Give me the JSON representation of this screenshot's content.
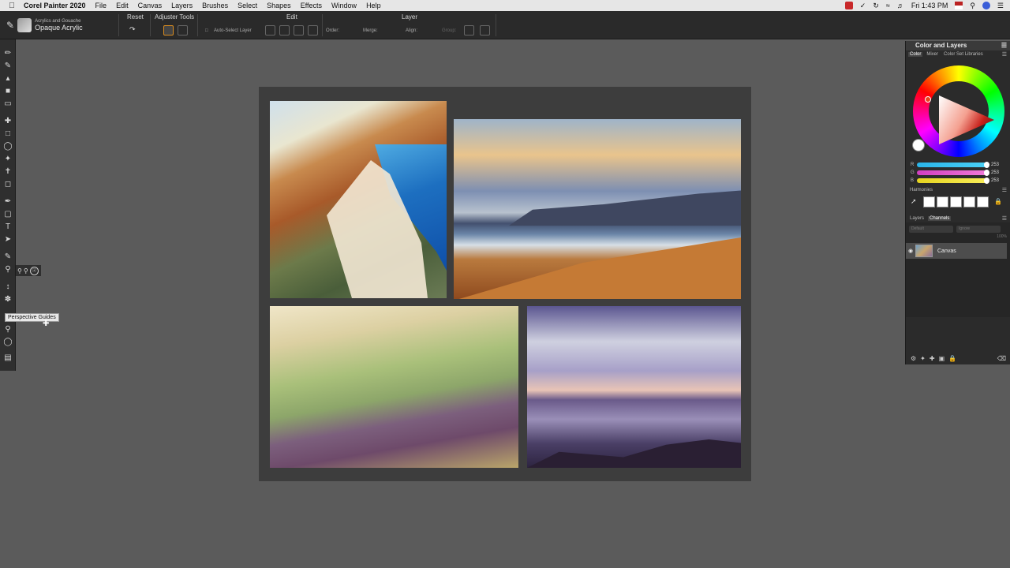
{
  "menubar": {
    "app_name": "Corel Painter 2020",
    "items": [
      "File",
      "Edit",
      "Canvas",
      "Layers",
      "Brushes",
      "Select",
      "Shapes",
      "Effects",
      "Window",
      "Help"
    ],
    "clock": "Fri 1:43 PM"
  },
  "propbar": {
    "brush_category": "Acrylics and Gouache",
    "brush_variant": "Opaque Acrylic",
    "reset_label": "Reset",
    "adjuster_tools_label": "Adjuster Tools",
    "edit_label": "Edit",
    "layer_label": "Layer",
    "auto_select_label": "Auto-Select Layer",
    "order_label": "Order:",
    "merge_label": "Merge:",
    "align_label": "Align:",
    "group_label": "Group:"
  },
  "toolbox": {
    "tooltip": "Perspective Guides"
  },
  "panel": {
    "title": "Color and Layers",
    "color_tabs": [
      "Color",
      "Mixer",
      "Color Set Libraries"
    ],
    "rgb": [
      {
        "label": "R",
        "value": "253",
        "color": "#4ad0f5"
      },
      {
        "label": "G",
        "value": "253",
        "color": "#e85fd0"
      },
      {
        "label": "B",
        "value": "253",
        "color": "#f5e83a"
      }
    ],
    "harmonies_label": "Harmonies",
    "layer_tabs": [
      "Layers",
      "Channels"
    ],
    "layer_mode": "Default",
    "layer_composite": "Ignore",
    "opacity": "100%",
    "layers": [
      {
        "name": "Canvas"
      }
    ]
  }
}
